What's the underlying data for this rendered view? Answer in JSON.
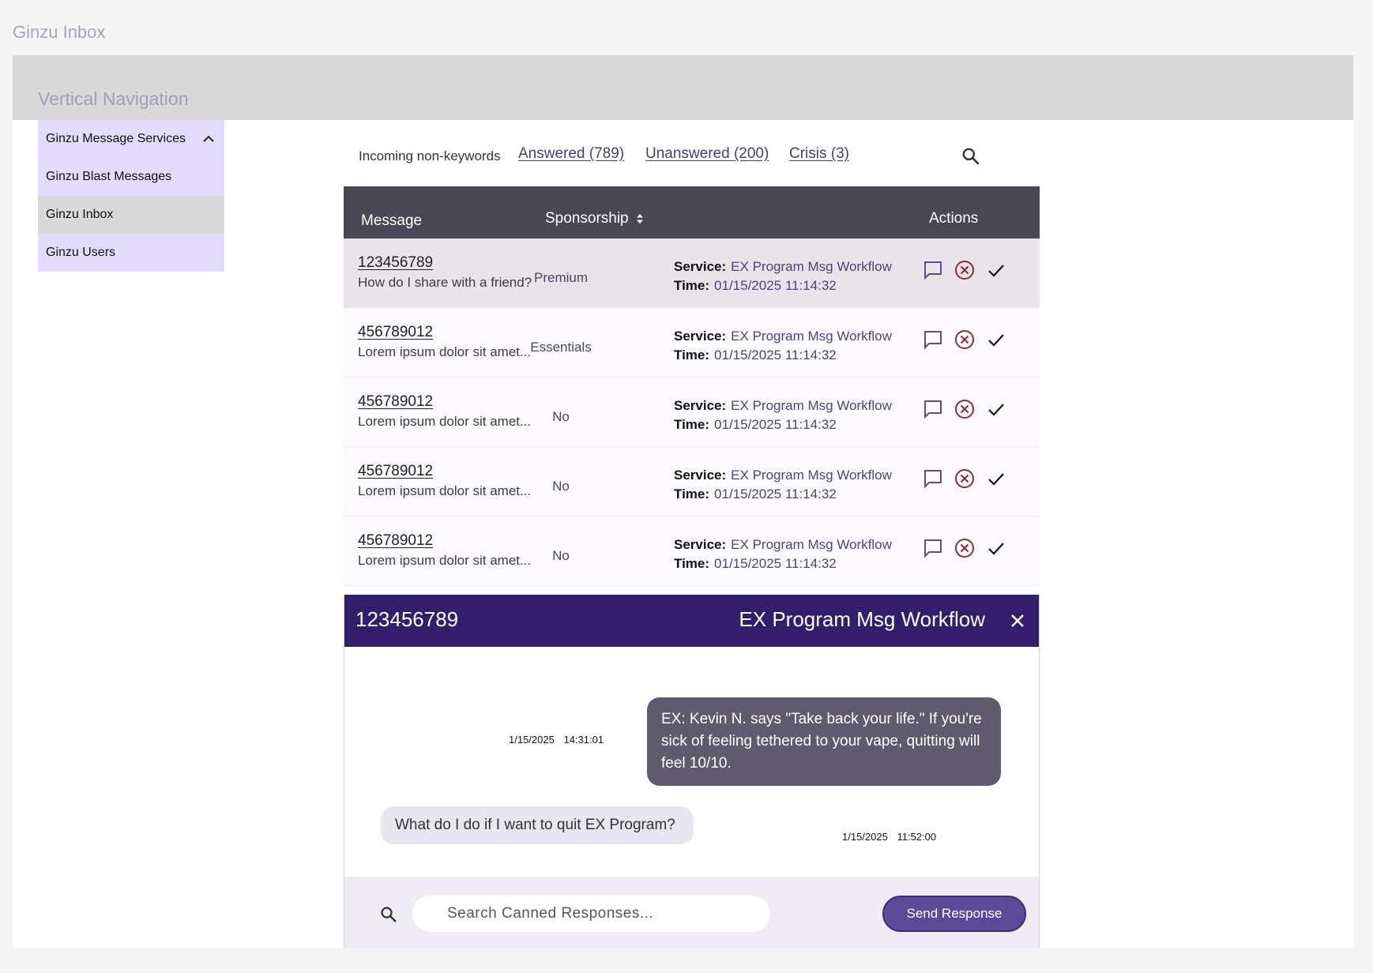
{
  "app": {
    "title": "Ginzu Inbox"
  },
  "topbar": {
    "label": "Vertical Navigation"
  },
  "sidebar": {
    "items": [
      {
        "label": "Ginzu Message Services",
        "icon": "chevron-up-icon"
      },
      {
        "label": "Ginzu Blast Messages"
      },
      {
        "label": "Ginzu Inbox",
        "active": true
      },
      {
        "label": "Ginzu Users"
      }
    ]
  },
  "tabs": {
    "incoming": "Incoming non-keywords",
    "answered": "Answered (789)",
    "unanswered": "Unanswered (200)",
    "crisis": "Crisis (3)"
  },
  "table": {
    "headers": {
      "message": "Message",
      "sponsorship": "Sponsorship",
      "actions": "Actions"
    },
    "service_label": "Service:",
    "time_label": "Time:",
    "rows": [
      {
        "number": "123456789",
        "message": "How do I share with a friend?",
        "sponsorship": "Premium",
        "service": "EX Program Msg Workflow",
        "time": "01/15/2025 11:14:32",
        "selected": true
      },
      {
        "number": "456789012",
        "message": "Lorem ipsum dolor sit amet...",
        "sponsorship": "Essentials",
        "service": "EX Program Msg Workflow",
        "time": "01/15/2025 11:14:32"
      },
      {
        "number": "456789012",
        "message": "Lorem ipsum dolor sit amet...",
        "sponsorship": "No",
        "service": "EX Program Msg Workflow",
        "time": "01/15/2025 11:14:32"
      },
      {
        "number": "456789012",
        "message": "Lorem ipsum dolor sit amet...",
        "sponsorship": "No",
        "service": "EX Program Msg Workflow",
        "time": "01/15/2025 11:14:32"
      },
      {
        "number": "456789012",
        "message": "Lorem ipsum dolor sit amet...",
        "sponsorship": "No",
        "service": "EX Program Msg Workflow",
        "time": "01/15/2025 11:14:32"
      }
    ]
  },
  "chat": {
    "number": "123456789",
    "service": "EX Program Msg Workflow",
    "messages": [
      {
        "direction": "outgoing",
        "text": "EX: Kevin N. says \"Take back your life.\" If you're sick of feeling tethered to your vape, quitting will feel 10/10.",
        "date": "1/15/2025",
        "time": "14:31:01"
      },
      {
        "direction": "incoming",
        "text": "What do I do if I want to quit EX Program?",
        "date": "1/15/2025",
        "time": "11:52:00"
      }
    ],
    "search_placeholder": "Search Canned Responses...",
    "send_label": "Send Response"
  },
  "colors": {
    "header_dark": "#4a4754",
    "chat_header": "#321f6c",
    "sidebar_bg": "#e3dcfc",
    "send_button": "#5b4a97",
    "reject_icon": "#8b2c35"
  }
}
